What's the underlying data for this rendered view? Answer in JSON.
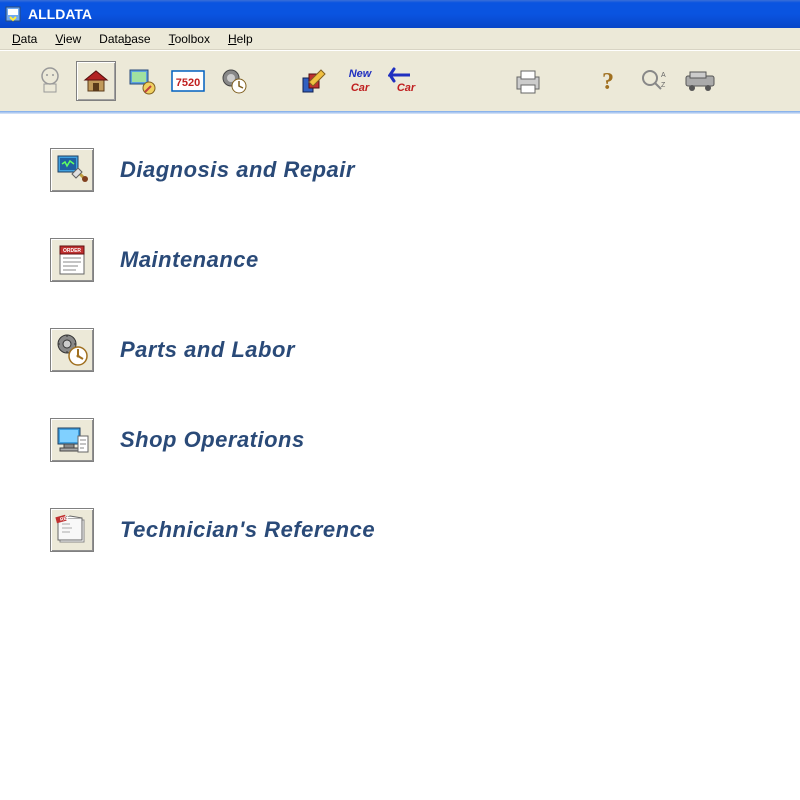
{
  "window": {
    "title": "ALLDATA"
  },
  "menu": {
    "items": [
      {
        "label": "Data",
        "underline": 0
      },
      {
        "label": "View",
        "underline": 0
      },
      {
        "label": "Database",
        "underline": 4
      },
      {
        "label": "Toolbox",
        "underline": 0
      },
      {
        "label": "Help",
        "underline": 0
      }
    ]
  },
  "toolbar": {
    "icons": [
      "computer-head-icon",
      "home-icon",
      "database-globe-icon",
      "tsb-7520-icon",
      "gear-clock-icon",
      "gap",
      "books-pencil-icon",
      "new-car-icon",
      "back-car-icon",
      "gap-lg",
      "print-icon",
      "gap",
      "help-question-icon",
      "search-az-icon",
      "vehicle-icon"
    ],
    "labels": {
      "new_car": "New",
      "car": "Car"
    },
    "tsb_number": "7520"
  },
  "main": {
    "items": [
      {
        "label": "Diagnosis and Repair",
        "icon": "diagnosis-repair-icon"
      },
      {
        "label": "Maintenance",
        "icon": "maintenance-order-icon"
      },
      {
        "label": "Parts and Labor",
        "icon": "parts-labor-clock-icon"
      },
      {
        "label": "Shop Operations",
        "icon": "shop-operations-icon"
      },
      {
        "label": "Technician's Reference",
        "icon": "reference-book-icon"
      }
    ]
  },
  "colors": {
    "title_bg": "#0a54e0",
    "chrome_bg": "#ece9d8",
    "link_text": "#2a4a78"
  }
}
